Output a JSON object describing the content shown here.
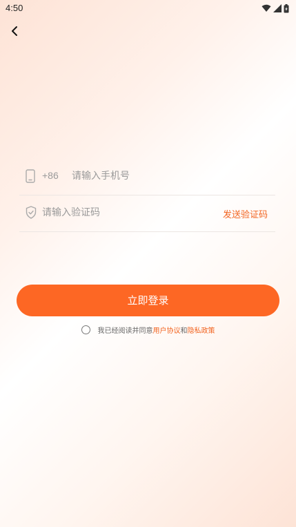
{
  "status_bar": {
    "time": "4:50",
    "icons": [
      "wifi-icon",
      "signal-icon",
      "battery-icon"
    ]
  },
  "nav": {
    "back_icon": "chevron-left-icon"
  },
  "form": {
    "phone": {
      "icon": "phone-icon",
      "country_code": "+86",
      "placeholder": "请输入手机号",
      "value": ""
    },
    "code": {
      "icon": "shield-icon",
      "placeholder": "请输入验证码",
      "value": "",
      "send_label": "发送验证码"
    },
    "login_label": "立即登录"
  },
  "agreement": {
    "checked": false,
    "prefix": "我已经阅读并同意",
    "user_agreement": "用户协议",
    "conjunction": "和",
    "privacy_policy": "隐私政策"
  },
  "colors": {
    "accent": "#fd6724",
    "link": "#f26522",
    "placeholder": "#9a9a9a",
    "divider": "#ece6e3"
  }
}
